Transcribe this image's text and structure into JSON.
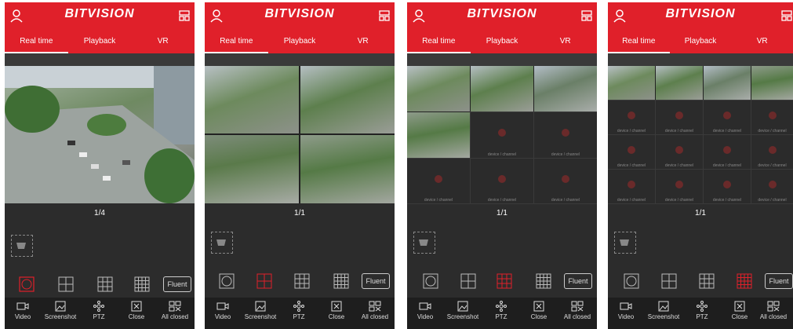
{
  "app": {
    "brand": "BITVISION",
    "tabs": [
      "Real time",
      "Playback",
      "VR"
    ]
  },
  "colors": {
    "accent": "#e0202a"
  },
  "channel_label": "device / channel",
  "split_options": [
    "1",
    "4",
    "9",
    "16"
  ],
  "stream_button": "Fluent",
  "bottom_toolbar": [
    {
      "label": "Video",
      "icon": "video-icon"
    },
    {
      "label": "Screenshot",
      "icon": "screenshot-icon"
    },
    {
      "label": "PTZ",
      "icon": "ptz-icon"
    },
    {
      "label": "Close",
      "icon": "close-window-icon"
    },
    {
      "label": "All closed",
      "icon": "all-closed-icon"
    }
  ],
  "panels": [
    {
      "page_indicator": "1/4",
      "active_split": "1"
    },
    {
      "page_indicator": "1/1",
      "active_split": "4"
    },
    {
      "page_indicator": "1/1",
      "active_split": "9"
    },
    {
      "page_indicator": "1/1",
      "active_split": "16"
    }
  ]
}
